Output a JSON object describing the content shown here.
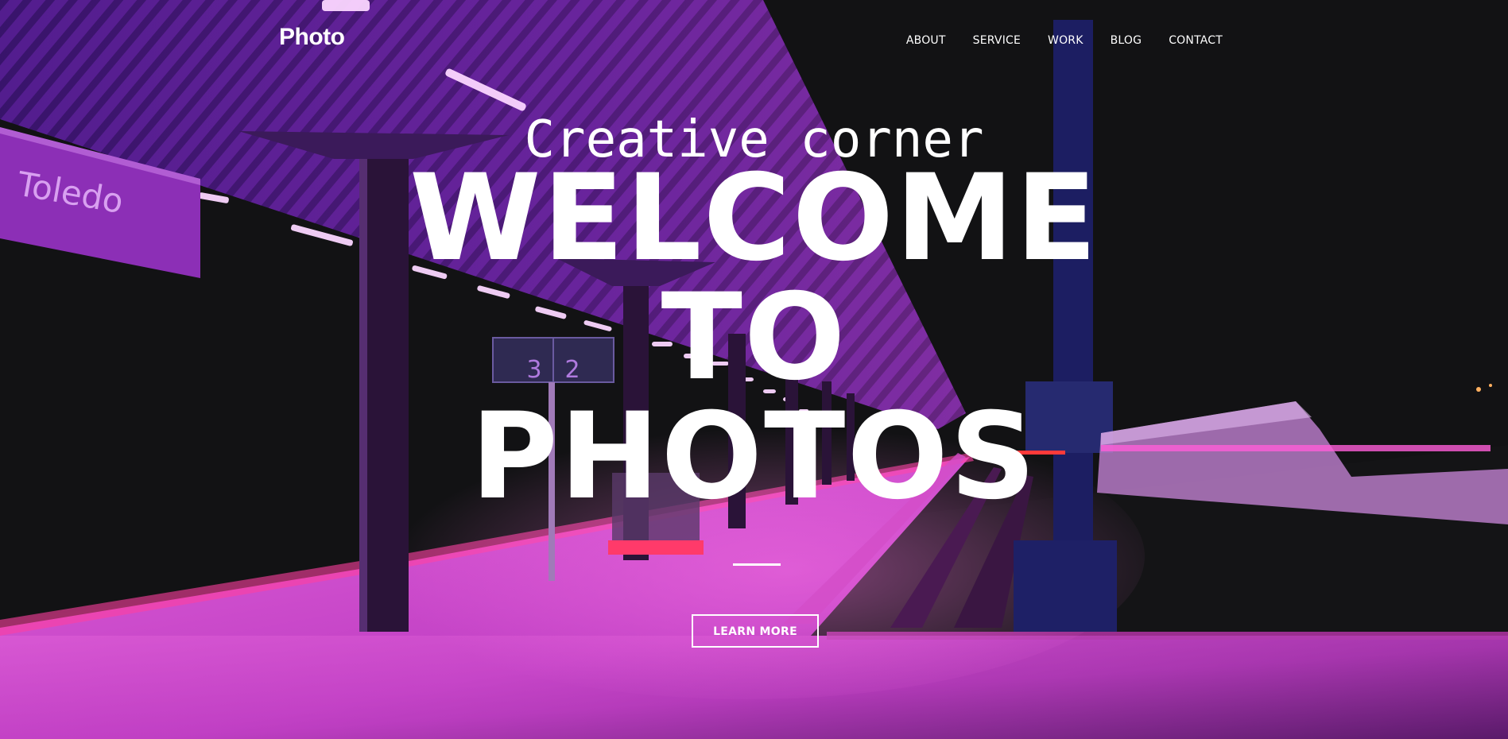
{
  "brand": {
    "logo": "Photo"
  },
  "nav": {
    "items": [
      {
        "label": "ABOUT"
      },
      {
        "label": "SERVICE"
      },
      {
        "label": "WORK"
      },
      {
        "label": "BLOG"
      },
      {
        "label": "CONTACT"
      }
    ]
  },
  "hero": {
    "subtitle": "Creative corner",
    "title_lines": [
      "WELCOME",
      "TO",
      "PHOTOS"
    ],
    "cta_label": "LEARN MORE"
  },
  "background": {
    "sign_text": "Toledo",
    "platform_numbers": [
      "3",
      "2"
    ],
    "accent_color": "#c83ad6",
    "dark_color": "#141416"
  }
}
